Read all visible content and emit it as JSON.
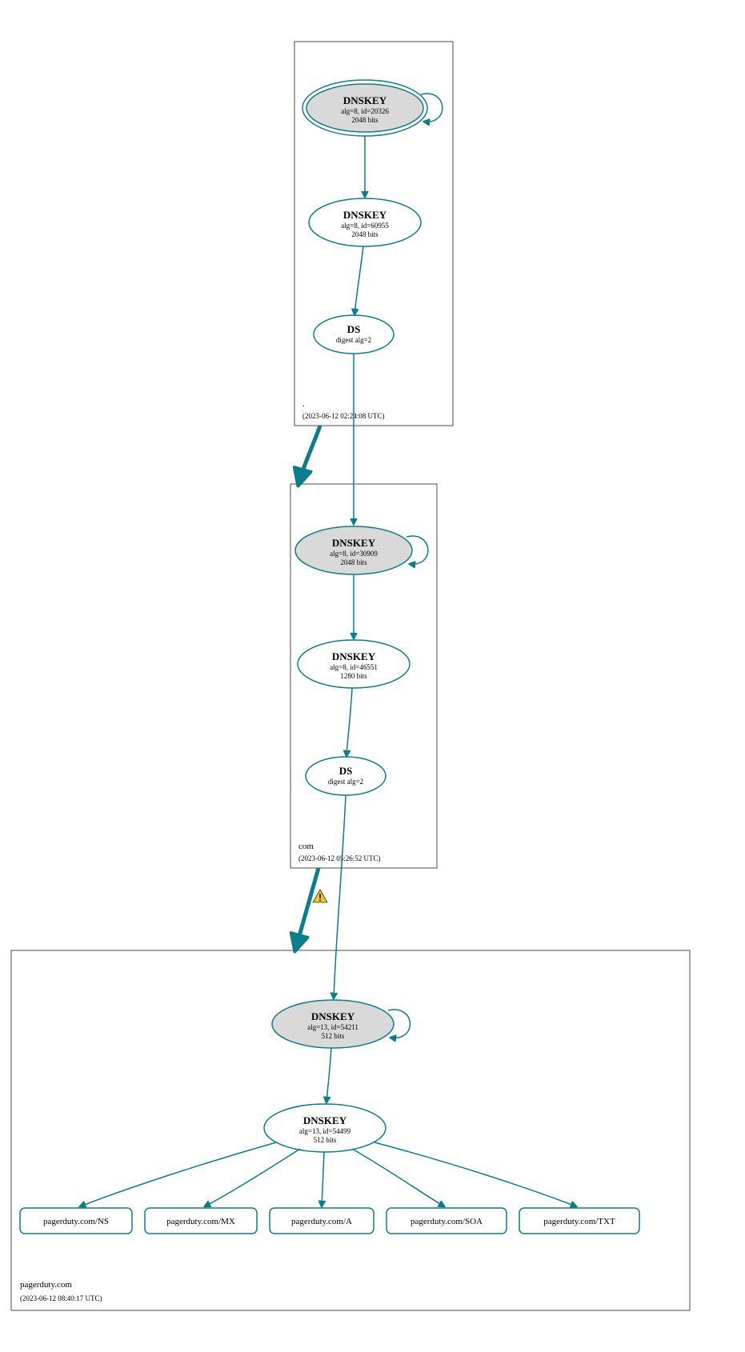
{
  "colors": {
    "stroke": "#0a7e8c",
    "ksk_fill": "#d9d9d9"
  },
  "zones": {
    "root": {
      "label": ".",
      "timestamp": "(2023-06-12 02:24:08 UTC)",
      "nodes": {
        "ksk": {
          "title": "DNSKEY",
          "line2": "alg=8, id=20326",
          "line3": "2048 bits"
        },
        "zsk": {
          "title": "DNSKEY",
          "line2": "alg=8, id=60955",
          "line3": "2048 bits"
        },
        "ds": {
          "title": "DS",
          "line2": "digest alg=2"
        }
      }
    },
    "com": {
      "label": "com",
      "timestamp": "(2023-06-12 05:26:52 UTC)",
      "nodes": {
        "ksk": {
          "title": "DNSKEY",
          "line2": "alg=8, id=30909",
          "line3": "2048 bits"
        },
        "zsk": {
          "title": "DNSKEY",
          "line2": "alg=8, id=46551",
          "line3": "1280 bits"
        },
        "ds": {
          "title": "DS",
          "line2": "digest alg=2"
        }
      }
    },
    "domain": {
      "label": "pagerduty.com",
      "timestamp": "(2023-06-12 08:40:17 UTC)",
      "nodes": {
        "ksk": {
          "title": "DNSKEY",
          "line2": "alg=13, id=54211",
          "line3": "512 bits"
        },
        "zsk": {
          "title": "DNSKEY",
          "line2": "alg=13, id=54499",
          "line3": "512 bits"
        }
      },
      "records": {
        "ns": "pagerduty.com/NS",
        "mx": "pagerduty.com/MX",
        "a": "pagerduty.com/A",
        "soa": "pagerduty.com/SOA",
        "txt": "pagerduty.com/TXT"
      }
    }
  }
}
